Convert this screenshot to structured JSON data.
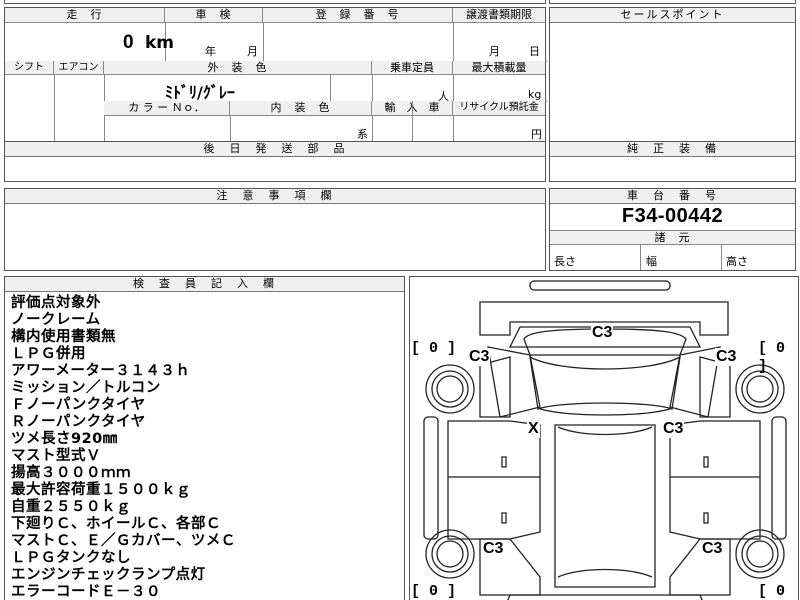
{
  "top_form": {
    "mileage": {
      "label": "走　行",
      "value": "0",
      "unit": "km"
    },
    "inspection": {
      "label": "車　検",
      "year_unit": "年",
      "month_unit": "月"
    },
    "registration": {
      "label": "登　録　番　号"
    },
    "transfer_docs": {
      "label": "譲渡書類期限",
      "month_unit": "月",
      "day_unit": "日"
    },
    "shift": {
      "label": "シフト"
    },
    "aircon": {
      "label": "エアコン"
    },
    "exterior_color": {
      "label": "外　装　色",
      "value": "ﾐﾄﾞﾘ/ｸﾞﾚｰ"
    },
    "capacity": {
      "label": "乗車定員",
      "unit": "人"
    },
    "max_load": {
      "label": "最大積載量",
      "unit": "kg"
    },
    "color_no": {
      "label": "カ ラ ー Ｎｏ．"
    },
    "interior_color": {
      "label": "内　装　色",
      "unit": "系"
    },
    "import_car": {
      "label": "輸　入　車"
    },
    "recycle": {
      "label": "リサイクル預託金",
      "unit": "円"
    },
    "later_parts": {
      "label": "後　日　発　送　部　品"
    }
  },
  "sales_point": {
    "label": "セールスポイント"
  },
  "genuine_equipment": {
    "label": "純　正　装　備"
  },
  "caution": {
    "label": "注　意　事　項　欄"
  },
  "chassis": {
    "label": "車　台　番　号",
    "value": "F34-00442"
  },
  "specs": {
    "label": "諸　元",
    "length_label": "長さ",
    "width_label": "幅",
    "height_label": "高さ"
  },
  "inspector": {
    "label": "検　査　員　記　入　欄",
    "notes": [
      "評価点対象外",
      "ノークレーム",
      "構内使用書類無",
      "ＬＰＧ併用",
      "アワーメーター３１４３ｈ",
      "ミッション／トルコン",
      "Ｆノーパンクタイヤ",
      "Ｒノーパンクタイヤ",
      "ツメ長さ920㎜",
      "マスト型式Ｖ",
      "揚高３０００ｍｍ",
      "最大許容荷重１５００ｋｇ",
      "自重２５５０ｋｇ",
      "下廻りＣ、ホイールＣ、各部Ｃ",
      "マストＣ、Ｅ／Ｇカバー、ツメＣ",
      "ＬＰＧタンクなし",
      "エンジンチェックランプ点灯",
      "エラーコードＥ－３０"
    ]
  },
  "diagram": {
    "marks": {
      "top": "C3",
      "front_left_wheel": "C3",
      "front_right_wheel": "C3",
      "x_mark": "X",
      "right_side": "C3",
      "rear_left_wheel": "C3",
      "rear_right_wheel": "C3"
    },
    "brackets": {
      "top_left": "[ 0 ]",
      "top_right": "[ 0 ]",
      "bottom_left": "[ 0 ]",
      "bottom_right": "[ 0 ]"
    }
  }
}
